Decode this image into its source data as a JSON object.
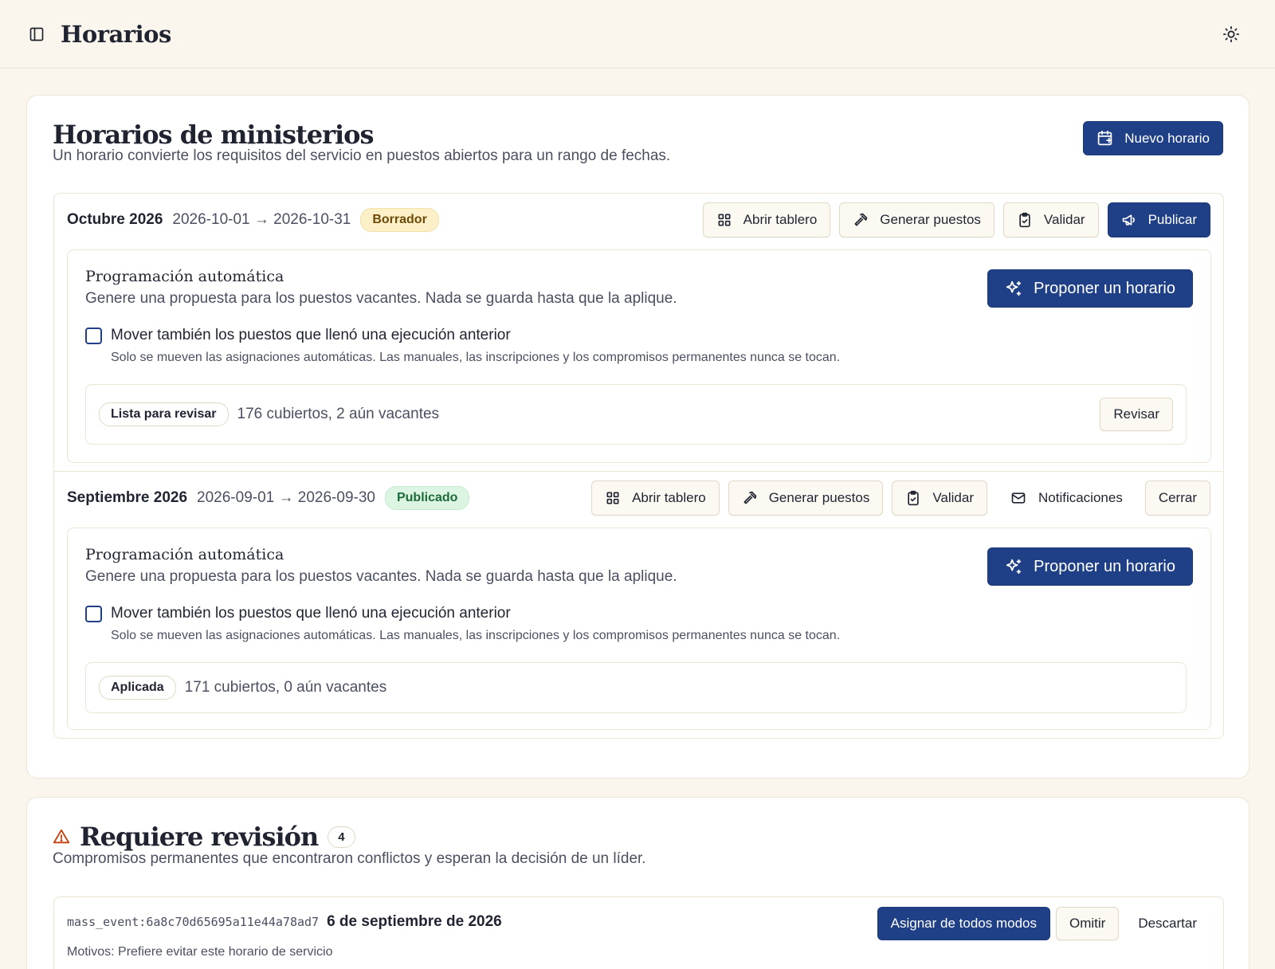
{
  "topbar": {
    "title": "Horarios",
    "sidebar_icon": "sidebar-toggle-icon",
    "theme_icon": "sun-icon"
  },
  "main": {
    "title": "Horarios de ministerios",
    "subtitle": "Un horario convierte los requisitos del servicio en puestos abiertos para un rango de fechas.",
    "new_button": "Nuevo horario",
    "schedules": [
      {
        "name": "Octubre 2026",
        "range": "2026-10-01 → 2026-10-31",
        "status": "Borrador",
        "actions": {
          "board": "Abrir tablero",
          "generate": "Generar puestos",
          "validate": "Validar",
          "publish": "Publicar"
        },
        "auto": {
          "title": "Programación automática",
          "description": "Genere una propuesta para los puestos vacantes. Nada se guarda hasta que la aplique.",
          "propose": "Proponer un horario",
          "checkbox_label": "Mover también los puestos que llenó una ejecución anterior",
          "checkbox_checked": false,
          "hint": "Solo se mueven las asignaciones automáticas. Las manuales, las inscripciones y los compromisos permanentes nunca se tocan.",
          "result_status": "Lista para revisar",
          "result_text": "176 cubiertos, 2 aún vacantes",
          "review": "Revisar"
        }
      },
      {
        "name": "Septiembre 2026",
        "range": "2026-09-01 → 2026-09-30",
        "status": "Publicado",
        "actions": {
          "board": "Abrir tablero",
          "generate": "Generar puestos",
          "validate": "Validar",
          "notifications": "Notificaciones",
          "close": "Cerrar"
        },
        "auto": {
          "title": "Programación automática",
          "description": "Genere una propuesta para los puestos vacantes. Nada se guarda hasta que la aplique.",
          "propose": "Proponer un horario",
          "checkbox_label": "Mover también los puestos que llenó una ejecución anterior",
          "checkbox_checked": false,
          "hint": "Solo se mueven las asignaciones automáticas. Las manuales, las inscripciones y los compromisos permanentes nunca se tocan.",
          "result_status": "Aplicada",
          "result_text": "171 cubiertos, 0 aún vacantes"
        }
      }
    ]
  },
  "review": {
    "title": "Requiere revisión",
    "count": "4",
    "subtitle": "Compromisos permanentes que encontraron conflictos y esperan la decisión de un líder.",
    "items": [
      {
        "id": "mass_event:6a8c70d65695a11e44a78ad7",
        "date": "6 de septiembre de 2026",
        "reason": "Motivos: Prefiere evitar este horario de servicio",
        "assign": "Asignar de todos modos",
        "skip": "Omitir",
        "dismiss": "Descartar"
      }
    ]
  },
  "colors": {
    "background": "#faf6ee",
    "primary": "#1f3f86",
    "draft_badge": "#fbf0c8",
    "published_badge": "#dcf5e3",
    "warning": "#c2410c"
  }
}
